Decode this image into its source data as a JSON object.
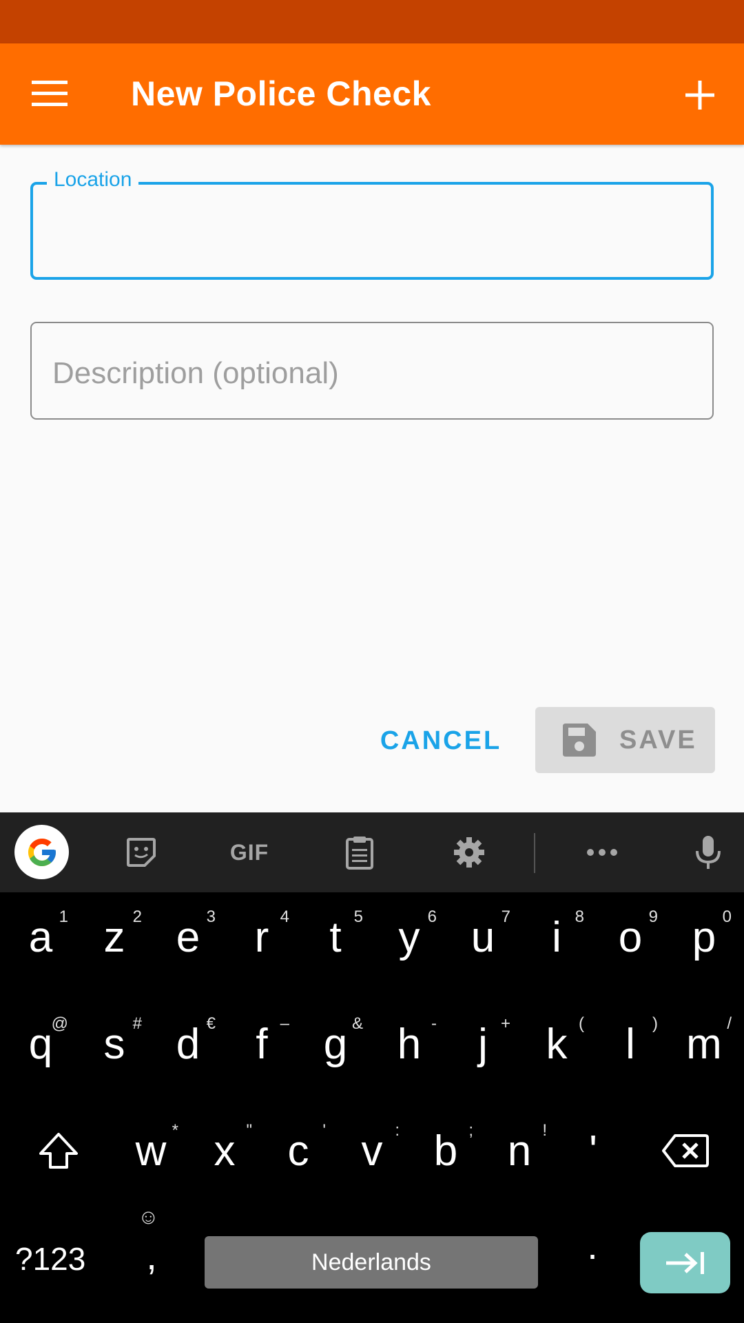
{
  "app_bar": {
    "title": "New Police Check",
    "menu_icon": "menu-icon",
    "add_icon": "plus-icon"
  },
  "colors": {
    "status_bar": "#c44200",
    "app_bar": "#ff6d00",
    "accent": "#1aa3e8",
    "save_disabled_bg": "#dcdcdc",
    "enter_key": "#7fcbc4"
  },
  "form": {
    "location_label": "Location",
    "location_value": "",
    "description_placeholder": "Description (optional)"
  },
  "actions": {
    "cancel_label": "CANCEL",
    "save_label": "SAVE",
    "save_icon": "floppy-disk-icon"
  },
  "keyboard": {
    "toolbar": {
      "gif_label": "GIF",
      "items": [
        "google-icon",
        "sticker-icon",
        "gif",
        "clipboard-icon",
        "settings-icon",
        "more-icon",
        "microphone-icon"
      ]
    },
    "row1": [
      {
        "key": "a",
        "hint": "1"
      },
      {
        "key": "z",
        "hint": "2"
      },
      {
        "key": "e",
        "hint": "3"
      },
      {
        "key": "r",
        "hint": "4"
      },
      {
        "key": "t",
        "hint": "5"
      },
      {
        "key": "y",
        "hint": "6"
      },
      {
        "key": "u",
        "hint": "7"
      },
      {
        "key": "i",
        "hint": "8"
      },
      {
        "key": "o",
        "hint": "9"
      },
      {
        "key": "p",
        "hint": "0"
      }
    ],
    "row2": [
      {
        "key": "q",
        "hint": "@"
      },
      {
        "key": "s",
        "hint": "#"
      },
      {
        "key": "d",
        "hint": "€"
      },
      {
        "key": "f",
        "hint": "–"
      },
      {
        "key": "g",
        "hint": "&"
      },
      {
        "key": "h",
        "hint": "-"
      },
      {
        "key": "j",
        "hint": "+"
      },
      {
        "key": "k",
        "hint": "("
      },
      {
        "key": "l",
        "hint": ")"
      },
      {
        "key": "m",
        "hint": "/"
      }
    ],
    "row3": [
      {
        "key": "w",
        "hint": "*"
      },
      {
        "key": "x",
        "hint": "\""
      },
      {
        "key": "c",
        "hint": "'"
      },
      {
        "key": "v",
        "hint": ":"
      },
      {
        "key": "b",
        "hint": ";"
      },
      {
        "key": "n",
        "hint": "!"
      },
      {
        "key": "'",
        "hint": ""
      }
    ],
    "symbols_label": "?123",
    "comma_label": ",",
    "emoji_hint": "☺",
    "space_label": "Nederlands",
    "period_label": "."
  }
}
